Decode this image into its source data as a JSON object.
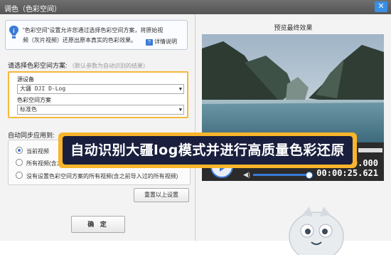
{
  "window": {
    "title": "调色（色彩空间）",
    "close_label": "✕"
  },
  "info": {
    "text": "“色彩空间”设置允许您通过选择色彩空间方案，将原始视频（灰片视频）还原出原本真实的色彩效果。",
    "help_label": "详情说明"
  },
  "scheme": {
    "label": "请选择色彩空间方案:",
    "hint": "（默认参数为自动识别的结果）",
    "source_label": "源设备",
    "source_value": "大疆 DJI D-Log",
    "space_label": "色彩空间方案",
    "space_value": "标准色"
  },
  "sync": {
    "label": "自动同步应用到:",
    "options": [
      {
        "label": "当前视频",
        "selected": true
      },
      {
        "label": "所有视频(含之前导入过的所有视频)",
        "selected": false
      },
      {
        "label": "没有设置色彩空间方案的所有视频(含之前导入过的所有视频)",
        "selected": false
      }
    ]
  },
  "buttons": {
    "reset": "重置以上设置",
    "ok": "确 定"
  },
  "preview": {
    "title": "预览最终效果",
    "time_current": "00:00:00.000",
    "time_total": "00:00:25.621"
  },
  "banner": {
    "text": "自动识别大疆log模式并进行高质量色彩还原"
  },
  "colors": {
    "accent": "#3a7bd5",
    "highlight": "#f5b93a",
    "banner_bg": "#1a1f3d"
  }
}
